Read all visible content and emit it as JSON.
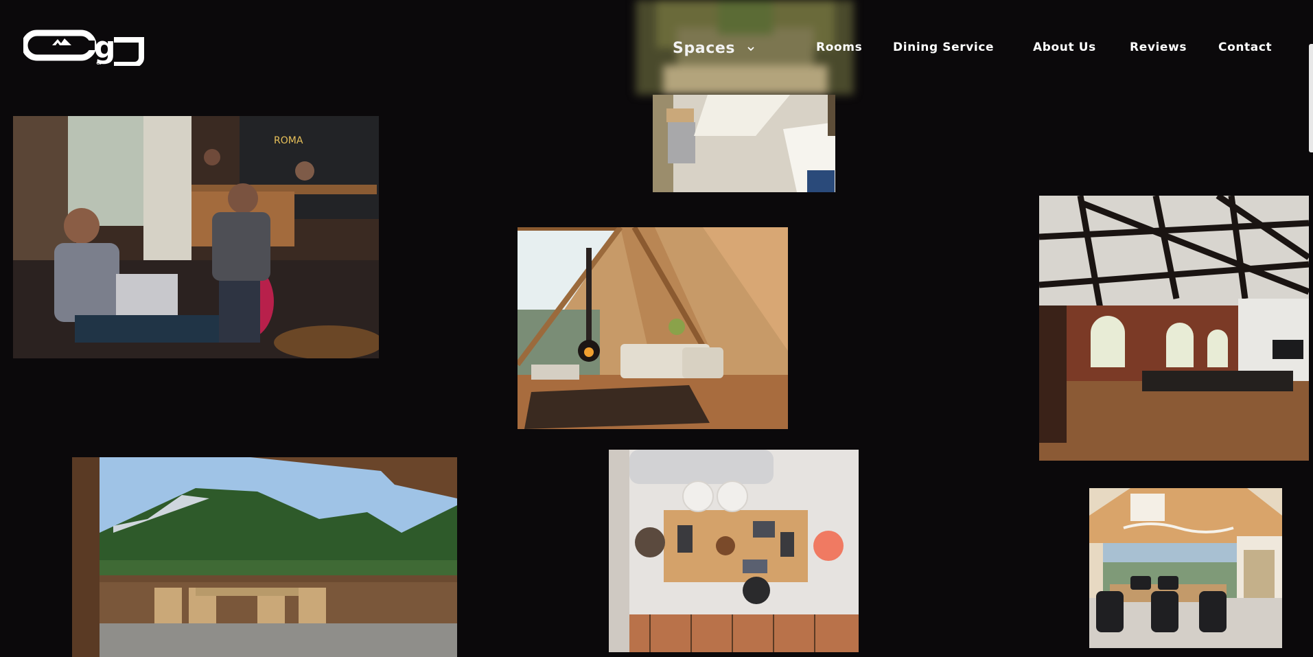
{
  "brand": {
    "logo_icon": "brand-monogram-logo"
  },
  "nav": {
    "spaces": "Spaces",
    "spaces_icon": "chevron-down-icon",
    "rooms": "Rooms",
    "dining": "Dining Service",
    "about": "About Us",
    "reviews": "Reviews",
    "contact": "Contact"
  },
  "gallery": {
    "photos": [
      "coworking-cafe-photo",
      "sunlit-room-photo",
      "a-frame-living-room-photo",
      "industrial-loft-photo",
      "mountain-balcony-photo",
      "overhead-meeting-table-photo",
      "chalet-meeting-room-photo"
    ]
  },
  "colors": {
    "background": "#0b090b",
    "nav_text": "#ffffff"
  }
}
